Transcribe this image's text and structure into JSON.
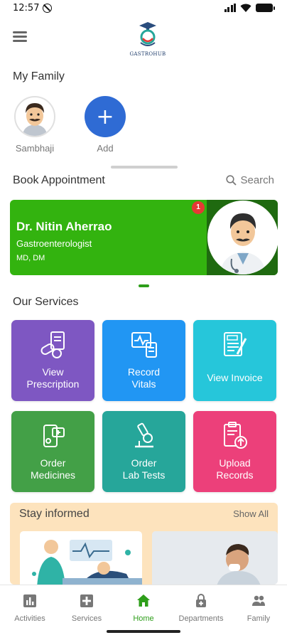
{
  "status_bar": {
    "time": "12:57"
  },
  "header": {
    "logo_text": "GASTROHUB"
  },
  "family": {
    "title": "My Family",
    "members": [
      {
        "name": "Sambhaji"
      }
    ],
    "add_label": "Add",
    "add_symbol": "+"
  },
  "appointment": {
    "title": "Book Appointment",
    "search_label": "Search",
    "doctor": {
      "name": "Dr. Nitin Aherrao",
      "specialty": "Gastroenterologist",
      "degree": "MD, DM",
      "badge_count": "1"
    }
  },
  "services": {
    "title": "Our Services",
    "tiles": [
      {
        "line1": "View",
        "line2": "Prescription",
        "color": "#7e57c2",
        "icon": "prescription-icon"
      },
      {
        "line1": "Record",
        "line2": "Vitals",
        "color": "#2196f3",
        "icon": "vitals-icon"
      },
      {
        "line1": "View Invoice",
        "line2": "",
        "color": "#26c6da",
        "icon": "invoice-icon"
      },
      {
        "line1": "Order",
        "line2": "Medicines",
        "color": "#43a047",
        "icon": "medicines-icon"
      },
      {
        "line1": "Order",
        "line2": "Lab Tests",
        "color": "#26a69a",
        "icon": "microscope-icon"
      },
      {
        "line1": "Upload",
        "line2": "Records",
        "color": "#ec407a",
        "icon": "upload-records-icon"
      }
    ]
  },
  "stay_informed": {
    "title": "Stay informed",
    "show_all": "Show All"
  },
  "bottom_nav": {
    "active": "Home",
    "items": [
      {
        "label": "Activities",
        "icon": "activities-icon"
      },
      {
        "label": "Services",
        "icon": "services-plus-icon"
      },
      {
        "label": "Home",
        "icon": "home-icon"
      },
      {
        "label": "Departments",
        "icon": "departments-icon"
      },
      {
        "label": "Family",
        "icon": "family-icon"
      }
    ]
  },
  "colors": {
    "doctor_card": "#33b30f",
    "accent_green": "#2e9e1a",
    "add_button": "#2f6bd4",
    "stay_bg": "#fde3bd"
  }
}
